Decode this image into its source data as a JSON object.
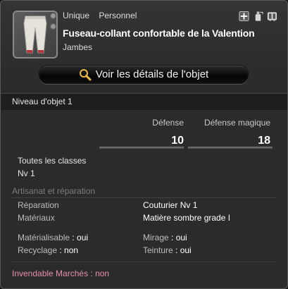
{
  "item": {
    "tags": [
      "Unique",
      "Personnel"
    ],
    "name": "Fuseau-collant confortable de la Valention",
    "slot": "Jambes",
    "icon": "pants-icon"
  },
  "header_icons": [
    "cross-icon",
    "dye-icon",
    "armoire-icon"
  ],
  "details_button": {
    "label": "Voir les détails de l'objet",
    "icon": "magnifier-icon"
  },
  "item_level": "Niveau d'objet 1",
  "stats": [
    {
      "label": "Défense",
      "value": "10"
    },
    {
      "label": "Défense magique",
      "value": "18"
    }
  ],
  "requirements": {
    "classes": "Toutes les classes",
    "level": "Nv 1"
  },
  "crafting": {
    "section_title": "Artisanat et réparation",
    "repair_label": "Réparation",
    "repair_value": "Couturier Nv 1",
    "materials_label": "Matériaux",
    "materials_value": "Matière sombre grade I",
    "materialize_label": "Matérialisable",
    "materialize_value": " : oui",
    "mirage_label": "Mirage",
    "mirage_value": " : oui",
    "recycle_label": "Recyclage",
    "recycle_value": " : non",
    "dye_label": "Teinture",
    "dye_value": " : oui"
  },
  "market": "Invendable Marchés : non",
  "colors": {
    "accent_pink": "#e88fb0",
    "panel": "#2b2b2b",
    "header": "#343434"
  }
}
